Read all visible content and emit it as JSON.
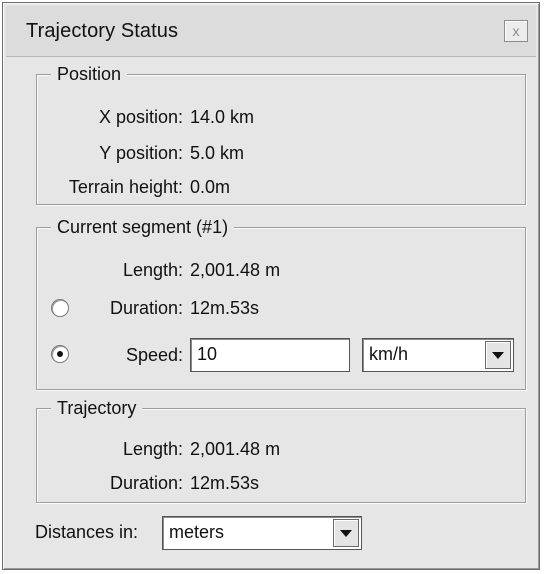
{
  "window": {
    "title": "Trajectory Status",
    "close_glyph": "x"
  },
  "position": {
    "legend": "Position",
    "x_label": "X position:",
    "x_value": "14.0 km",
    "y_label": "Y position:",
    "y_value": "5.0 km",
    "terrain_label": "Terrain height:",
    "terrain_value": "0.0m"
  },
  "segment": {
    "legend": "Current segment (#1)",
    "length_label": "Length:",
    "length_value": "2,001.48 m",
    "duration_label": "Duration:",
    "duration_value": "12m.53s",
    "duration_selected": false,
    "speed_label": "Speed:",
    "speed_value": "10",
    "speed_selected": true,
    "speed_unit": "km/h"
  },
  "trajectory": {
    "legend": "Trajectory",
    "length_label": "Length:",
    "length_value": "2,001.48 m",
    "duration_label": "Duration:",
    "duration_value": "12m.53s"
  },
  "distances": {
    "label": "Distances in:",
    "value": "meters"
  },
  "icons": {
    "close": "close-icon",
    "dropdown": "chevron-down-icon"
  }
}
